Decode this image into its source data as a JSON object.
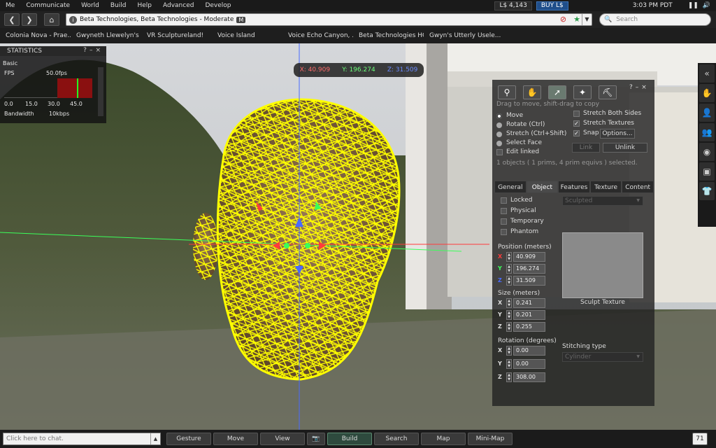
{
  "menu": {
    "items": [
      "Me",
      "Communicate",
      "World",
      "Build",
      "Help",
      "Advanced",
      "Develop"
    ],
    "balance": "L$ 4,143",
    "buy": "BUY L$",
    "time": "3:03 PM PDT"
  },
  "nav": {
    "address": "Beta Technologies, Beta Technologies - Moderate",
    "maturity": "M",
    "search_placeholder": "Search"
  },
  "favorites": [
    "Colonia Nova - Prae...",
    "Gwyneth Llewelyn's ...",
    "VR Sculptureland!",
    "Voice Island",
    "Voice Echo Canyon, ...",
    "Beta Technologies HQ",
    "Gwyn's Utterly Usele..."
  ],
  "statistics": {
    "title": "STATISTICS",
    "basic": "Basic",
    "fps_label": "FPS",
    "fps_value": "50.0fps",
    "ticks": [
      "0.0",
      "15.0",
      "30.0",
      "45.0"
    ],
    "bandwidth_label": "Bandwidth",
    "bandwidth_value": "10kbps"
  },
  "coords": {
    "x": "X: 40.909",
    "y": "Y: 196.274",
    "z": "Z: 31.509"
  },
  "tools": {
    "hint": "Drag to move, shift-drag to copy",
    "modes": [
      "Move",
      "Rotate (Ctrl)",
      "Stretch (Ctrl+Shift)",
      "Select Face"
    ],
    "edit_linked": "Edit linked",
    "stretch_both": "Stretch Both Sides",
    "stretch_textures": "Stretch Textures",
    "snap": "Snap",
    "options": "Options...",
    "link": "Link",
    "unlink": "Unlink",
    "selected": "1 objects ( 1 prims, 4 prim equivs ) selected.",
    "tabs": [
      "General",
      "Object",
      "Features",
      "Texture",
      "Content"
    ],
    "flags": [
      "Locked",
      "Physical",
      "Temporary",
      "Phantom"
    ],
    "prim_type": "Sculpted",
    "position_label": "Position (meters)",
    "position": {
      "x": "40.909",
      "y": "196.274",
      "z": "31.509"
    },
    "size_label": "Size (meters)",
    "size": {
      "x": "0.241",
      "y": "0.201",
      "z": "0.255"
    },
    "rotation_label": "Rotation (degrees)",
    "rotation": {
      "x": "0.00",
      "y": "0.00",
      "z": "308.00"
    },
    "sculpt_texture": "Sculpt Texture",
    "stitching_label": "Stitching type",
    "stitching": "Cylinder",
    "axes": [
      "X",
      "Y",
      "Z"
    ]
  },
  "bottom": {
    "chat_placeholder": "Click here to chat.",
    "buttons": [
      "Gesture",
      "Move",
      "View",
      "Build",
      "Search",
      "Map",
      "Mini-Map"
    ],
    "badge": "71"
  },
  "colors": {
    "wireframe": "#ffff00",
    "x_axis": "#ff3b3b",
    "y_axis": "#3bff5a",
    "z_axis": "#4a6bff"
  }
}
